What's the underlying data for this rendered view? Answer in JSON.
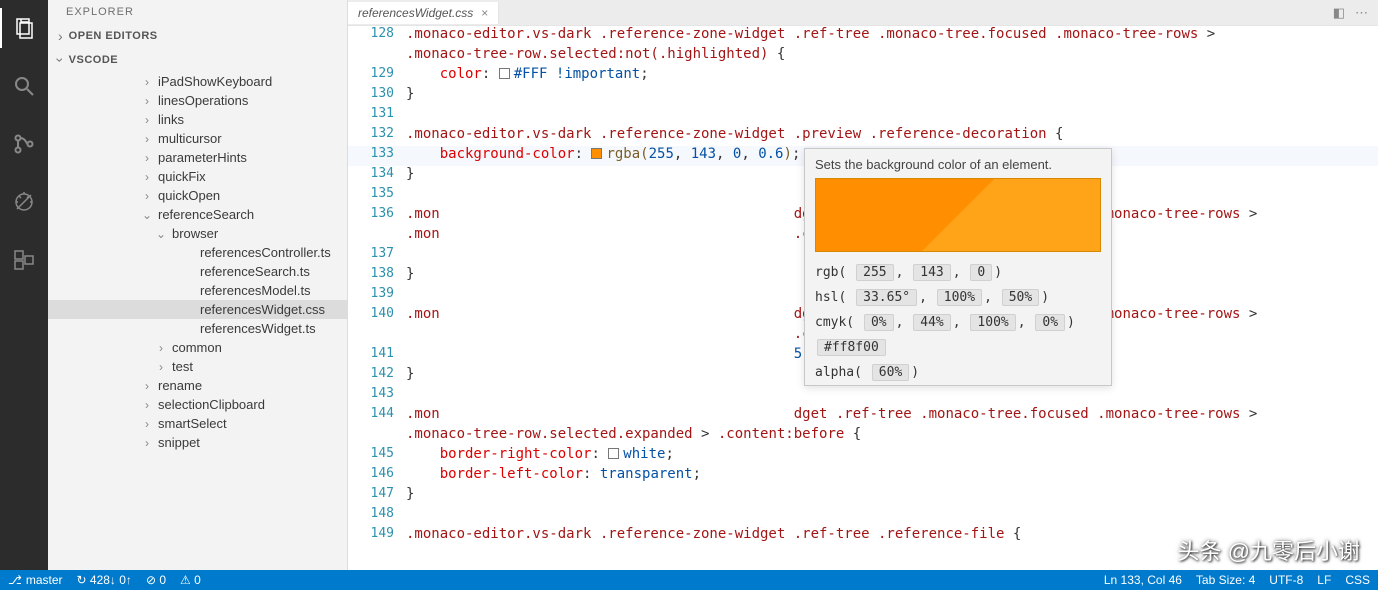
{
  "activity": {
    "items": [
      "files-icon",
      "search-icon",
      "git-icon",
      "debug-icon",
      "extensions-icon"
    ]
  },
  "sidebar": {
    "title": "EXPLORER",
    "sections": [
      {
        "label": "OPEN EDITORS",
        "open": false
      },
      {
        "label": "VSCODE",
        "open": true
      }
    ],
    "tree": [
      {
        "d": 1,
        "twist": "›",
        "label": "iPadShowKeyboard"
      },
      {
        "d": 1,
        "twist": "›",
        "label": "linesOperations"
      },
      {
        "d": 1,
        "twist": "›",
        "label": "links"
      },
      {
        "d": 1,
        "twist": "›",
        "label": "multicursor"
      },
      {
        "d": 1,
        "twist": "›",
        "label": "parameterHints"
      },
      {
        "d": 1,
        "twist": "›",
        "label": "quickFix"
      },
      {
        "d": 1,
        "twist": "›",
        "label": "quickOpen"
      },
      {
        "d": 1,
        "twist": "⌄",
        "label": "referenceSearch"
      },
      {
        "d": 2,
        "twist": "⌄",
        "label": "browser"
      },
      {
        "d": 3,
        "twist": "",
        "label": "referencesController.ts"
      },
      {
        "d": 3,
        "twist": "",
        "label": "referenceSearch.ts"
      },
      {
        "d": 3,
        "twist": "",
        "label": "referencesModel.ts"
      },
      {
        "d": 3,
        "twist": "",
        "label": "referencesWidget.css",
        "selected": true
      },
      {
        "d": 3,
        "twist": "",
        "label": "referencesWidget.ts"
      },
      {
        "d": 2,
        "twist": "›",
        "label": "common"
      },
      {
        "d": 2,
        "twist": "›",
        "label": "test"
      },
      {
        "d": 1,
        "twist": "›",
        "label": "rename"
      },
      {
        "d": 1,
        "twist": "›",
        "label": "selectionClipboard"
      },
      {
        "d": 1,
        "twist": "›",
        "label": "smartSelect"
      },
      {
        "d": 1,
        "twist": "›",
        "label": "snippet"
      }
    ]
  },
  "tabs": {
    "open": [
      {
        "label": "referencesWidget.css"
      }
    ]
  },
  "editor": {
    "lines": [
      {
        "n": 128,
        "html": "<span class='sel'>.monaco-editor.vs-dark .reference-zone-widget .ref-tree .monaco-tree.focused .monaco-tree-rows</span> > "
      },
      {
        "n": "",
        "html": "<span class='sel'>.monaco-tree-row.selected:not(.highlighted)</span> {"
      },
      {
        "n": 129,
        "html": "    <span class='prop'>color</span>: <span class='swatch' style='background:#fff'></span><span class='val'>#FFF</span> <span class='val'>!important</span>;"
      },
      {
        "n": 130,
        "html": "}"
      },
      {
        "n": 131,
        "html": ""
      },
      {
        "n": 132,
        "html": "<span class='sel'>.monaco-editor.vs-dark .reference-zone-widget .preview .reference-decoration</span> {"
      },
      {
        "n": 133,
        "current": true,
        "html": "    <span class='prop'>background-color</span>: <span class='swatch' style='background:#ff8f00'></span><span class='func'>rgba(</span><span class='val'>255</span>, <span class='val'>143</span>, <span class='val'>0</span>, <span class='val'>0.6</span><span class='func'>)</span>;"
      },
      {
        "n": 134,
        "html": "}"
      },
      {
        "n": 135,
        "html": ""
      },
      {
        "n": 136,
        "html": "<span class='sel'>.mon</span>                                          <span class='sel'>dget .ref-tree .monaco-tree.focused .monaco-tree-rows</span> > "
      },
      {
        "n": "",
        "html": "<span class='sel'>.mon</span>                                          <span class='sel'>.content:before</span>    {"
      },
      {
        "n": 137,
        "html": ""
      },
      {
        "n": 138,
        "html": "}"
      },
      {
        "n": 139,
        "html": ""
      },
      {
        "n": 140,
        "html": "<span class='sel'>.mon</span>                                          <span class='sel'>dget .ref-tree .monaco-tree.focused .monaco-tree-rows</span> > "
      },
      {
        "n": "",
        "html": "                                              <span class='sel'>.content:after</span> {"
      },
      {
        "n": 141,
        "html": "                                              <span class='val'>5</span>, <span class='val'>.2</span>);"
      },
      {
        "n": 142,
        "html": "}"
      },
      {
        "n": 143,
        "html": ""
      },
      {
        "n": 144,
        "html": "<span class='sel'>.mon</span>                                          <span class='sel'>dget .ref-tree .monaco-tree.focused .monaco-tree-rows</span> > "
      },
      {
        "n": "",
        "html": "<span class='sel'>.monaco-tree-row.selected.expanded</span> &gt; <span class='sel'>.content:before</span> {"
      },
      {
        "n": 145,
        "html": "    <span class='prop'>border-right-color</span>: <span class='swatch' style='background:#fff'></span><span class='val'>white</span>;"
      },
      {
        "n": 146,
        "html": "    <span class='prop'>border-left-color</span>: <span class='val'>transparent</span>;"
      },
      {
        "n": 147,
        "html": "}"
      },
      {
        "n": 148,
        "html": ""
      },
      {
        "n": 149,
        "html": "<span class='sel'>.monaco-editor.vs-dark .reference-zone-widget .ref-tree .reference-file</span> {"
      }
    ]
  },
  "hover": {
    "desc": "Sets the background color of an element.",
    "rgb_label": "rgb(",
    "rgb": [
      "255",
      "143",
      "0"
    ],
    "hsl_label": "hsl(",
    "hsl": [
      "33.65°",
      "100%",
      "50%"
    ],
    "cmyk_label": "cmyk(",
    "cmyk": [
      "0%",
      "44%",
      "100%",
      "0%"
    ],
    "hex": "#ff8f00",
    "alpha_label": "alpha(",
    "alpha": "60%"
  },
  "statusbar": {
    "left": {
      "branch_icon": "⎇",
      "branch": "master",
      "sync": "↻ 428↓ 0↑",
      "errors": "⊘ 0",
      "warnings": "⚠ 0"
    },
    "right": {
      "cursor": "Ln 133, Col 46",
      "tabsize": "Tab Size: 4",
      "encoding": "UTF-8",
      "eol": "LF",
      "lang": "CSS"
    }
  },
  "watermark": "头条 @九零后小谢"
}
